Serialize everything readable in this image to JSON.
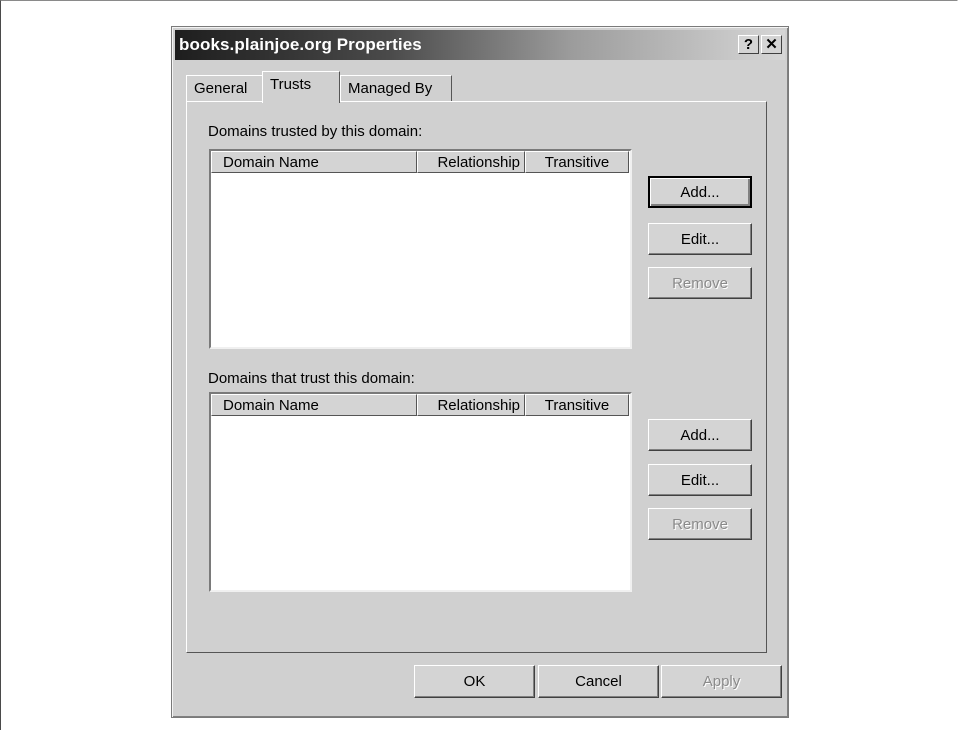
{
  "window": {
    "title": "books.plainjoe.org Properties",
    "help_label": "?",
    "close_label": "✕"
  },
  "tabs": [
    {
      "label": "General"
    },
    {
      "label": "Trusts"
    },
    {
      "label": "Managed By"
    }
  ],
  "active_tab": "Trusts",
  "trusted_by": {
    "label": "Domains trusted by this domain:",
    "columns": [
      "Domain Name",
      "Relationship",
      "Transitive"
    ],
    "rows": [],
    "buttons": {
      "add": "Add...",
      "edit": "Edit...",
      "remove": "Remove"
    }
  },
  "trust_this": {
    "label": "Domains that trust this domain:",
    "columns": [
      "Domain Name",
      "Relationship",
      "Transitive"
    ],
    "rows": [],
    "buttons": {
      "add": "Add...",
      "edit": "Edit...",
      "remove": "Remove"
    }
  },
  "footer": {
    "ok": "OK",
    "cancel": "Cancel",
    "apply": "Apply"
  },
  "icons": {
    "help": "help-icon",
    "close": "close-icon"
  }
}
